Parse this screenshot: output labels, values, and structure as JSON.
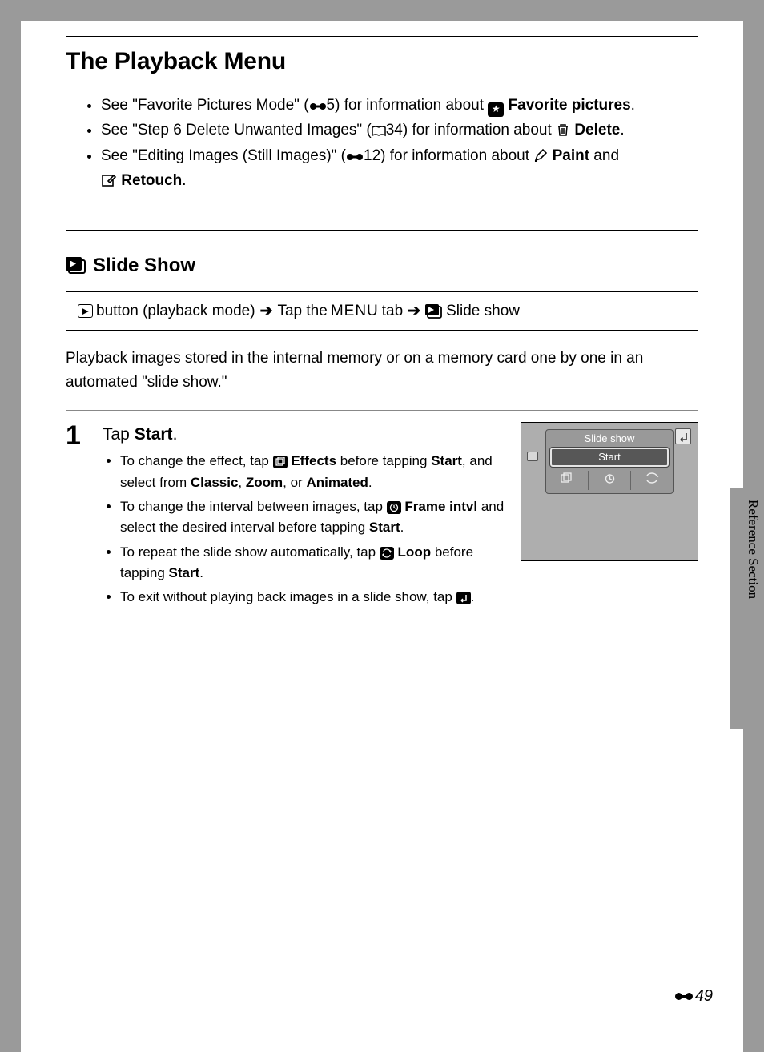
{
  "page": {
    "title": "The Playback Menu",
    "section_label": "Reference Section",
    "page_number": "49"
  },
  "bullets": {
    "b1_pre": "See \"Favorite Pictures Mode\" (",
    "b1_ref": "5) for information about ",
    "b1_bold": "Favorite pictures",
    "b2_pre": "See \"Step 6 Delete Unwanted Images\" (",
    "b2_ref": "34) for information about ",
    "b2_bold": "Delete",
    "b3_pre": "See \"Editing Images (Still Images)\" (",
    "b3_ref": "12) for information about ",
    "b3_bold1": "Paint",
    "b3_and": " and ",
    "b3_bold2": "Retouch"
  },
  "subsection": {
    "title": "Slide Show",
    "nav_button": "button (playback mode)",
    "nav_tap": "Tap the",
    "nav_menu": "MENU",
    "nav_tab": "tab",
    "nav_slide": "Slide show",
    "desc": "Playback images stored in the internal memory or on a memory card one by one in an automated \"slide show.\""
  },
  "step": {
    "num": "1",
    "title_pre": "Tap ",
    "title_bold": "Start",
    "s1a": "To change the effect, tap ",
    "s1a_bold": "Effects",
    "s1a_post": " before tapping ",
    "s1a_bold2": "Start",
    "s1a_post2": ", and select from ",
    "s1a_c": "Classic",
    "s1a_z": "Zoom",
    "s1a_or": ", or ",
    "s1a_a": "Animated",
    "s1b": "To change the interval between images, tap ",
    "s1b_bold": "Frame intvl",
    "s1b_post": " and select the desired interval before tapping ",
    "s1b_bold2": "Start",
    "s1c": "To repeat the slide show automatically, tap ",
    "s1c_bold": "Loop",
    "s1c_post": " before tapping ",
    "s1c_bold2": "Start",
    "s1d": "To exit without playing back images in a slide show, tap "
  },
  "mock": {
    "title": "Slide show",
    "start": "Start"
  }
}
